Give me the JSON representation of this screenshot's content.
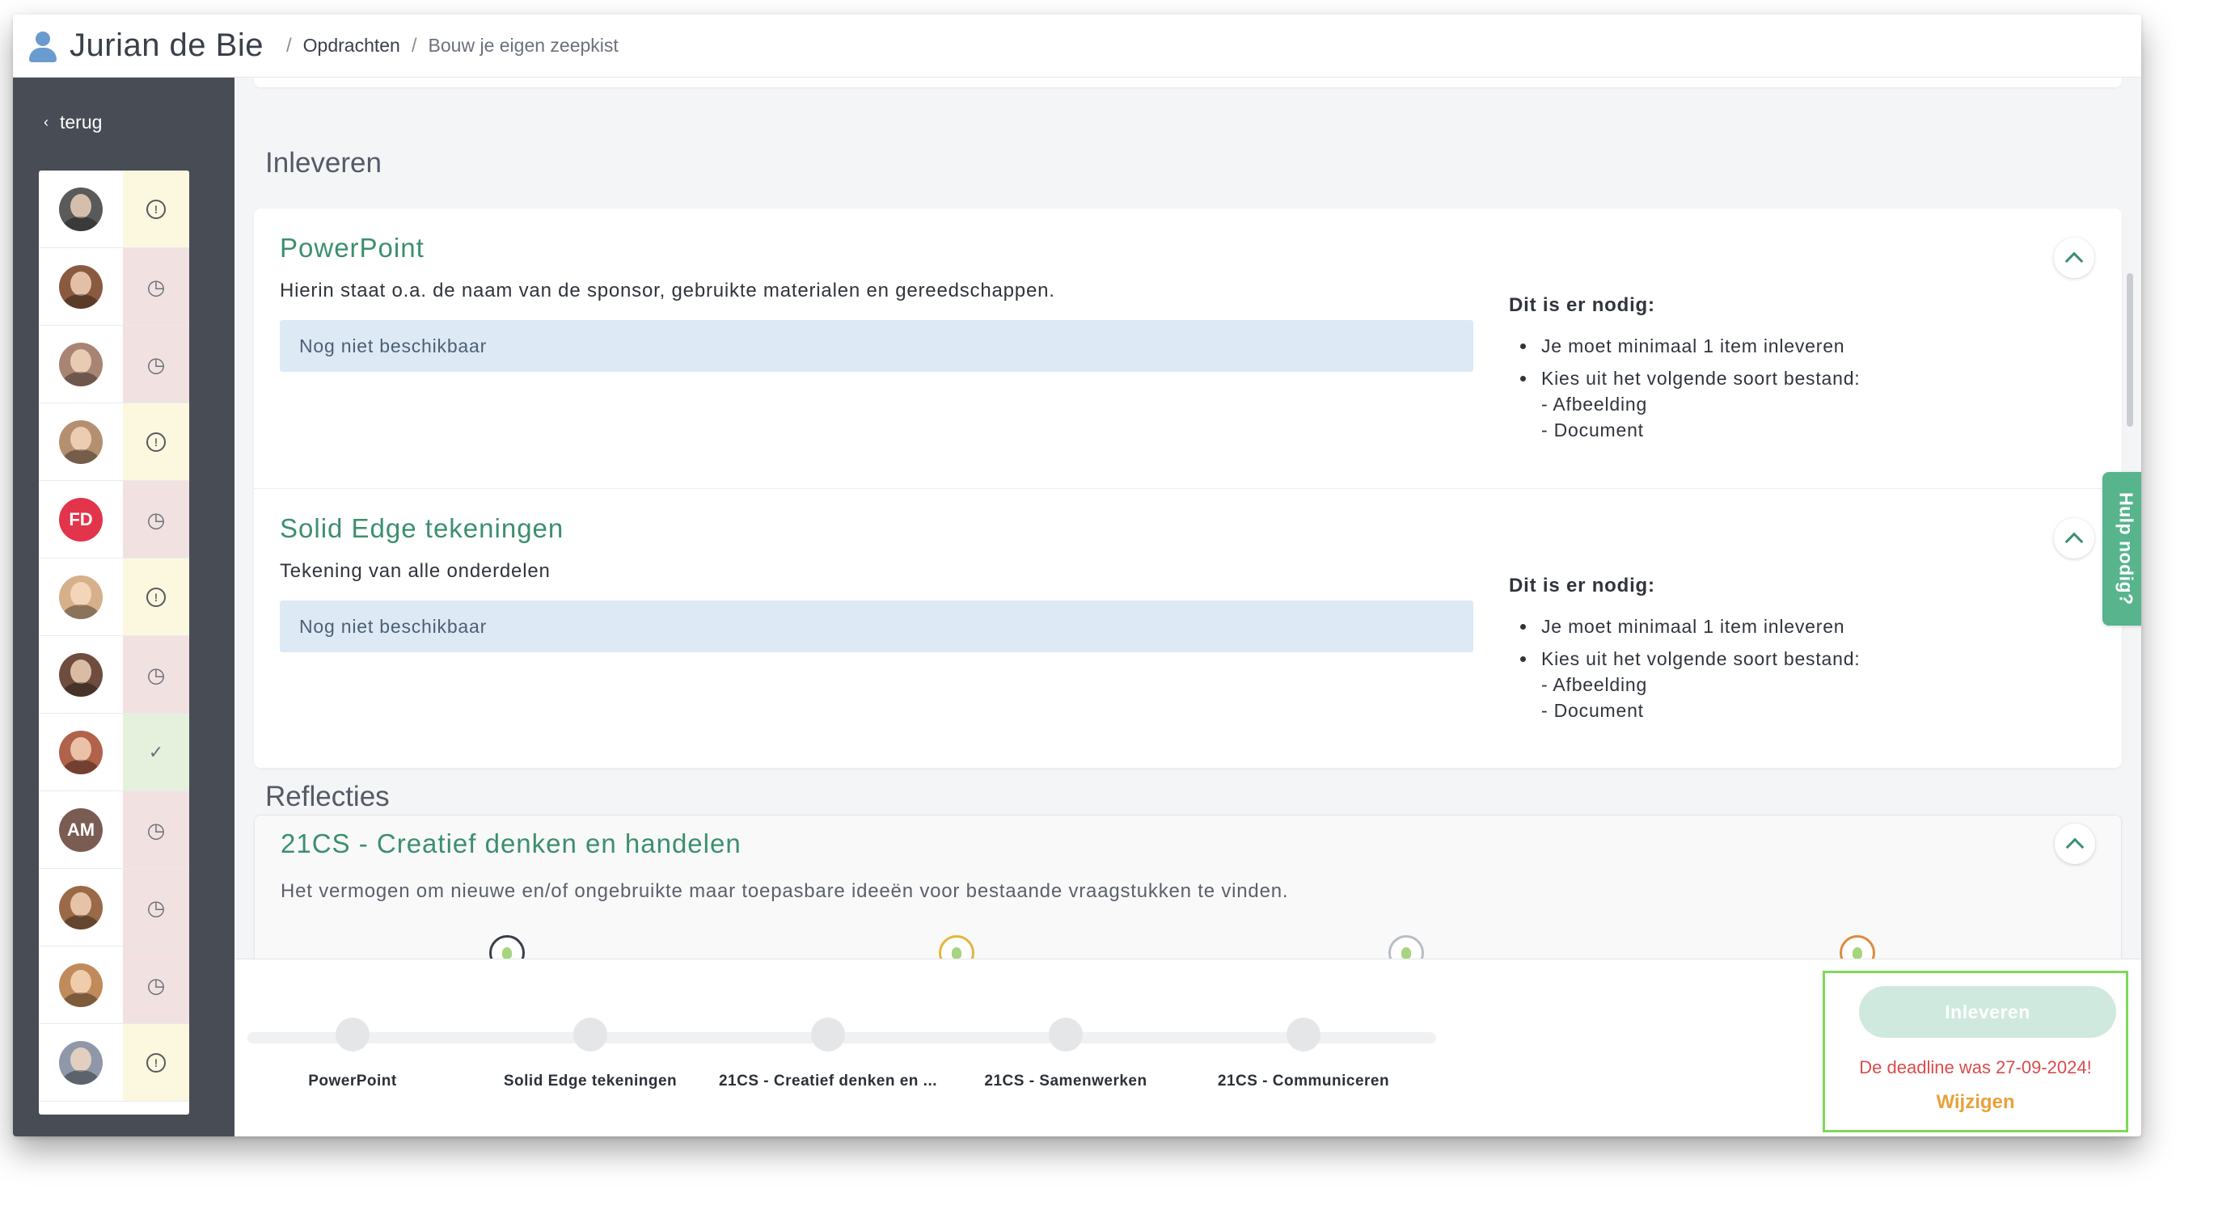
{
  "header": {
    "user_name": "Jurian de Bie",
    "breadcrumb": [
      {
        "label": "Opdrachten",
        "separator": "/"
      },
      {
        "label": "Bouw je eigen zeepkist",
        "separator": "/"
      }
    ]
  },
  "sidebar": {
    "back_label": "terug",
    "students": [
      {
        "avatar": "photo",
        "color": "#5a5a5a",
        "initials": "",
        "status": "warning",
        "status_icon": "!"
      },
      {
        "avatar": "photo",
        "color": "#8a5a40",
        "initials": "",
        "status": "late",
        "status_icon": "clock"
      },
      {
        "avatar": "photo",
        "color": "#a88474",
        "initials": "",
        "status": "late",
        "status_icon": "clock"
      },
      {
        "avatar": "photo",
        "color": "#b49070",
        "initials": "",
        "status": "warning",
        "status_icon": "!"
      },
      {
        "avatar": "initials",
        "color": "#e2344a",
        "initials": "FD",
        "status": "late",
        "status_icon": "clock"
      },
      {
        "avatar": "photo",
        "color": "#d6b08a",
        "initials": "",
        "status": "warning",
        "status_icon": "!"
      },
      {
        "avatar": "photo",
        "color": "#6e4d3f",
        "initials": "",
        "status": "late",
        "status_icon": "clock"
      },
      {
        "avatar": "photo",
        "color": "#b0624a",
        "initials": "",
        "status": "done",
        "status_icon": "check"
      },
      {
        "avatar": "initials",
        "color": "#7a5c52",
        "initials": "AM",
        "status": "late",
        "status_icon": "clock"
      },
      {
        "avatar": "photo",
        "color": "#9a6a48",
        "initials": "",
        "status": "late",
        "status_icon": "clock"
      },
      {
        "avatar": "photo",
        "color": "#c08a5a",
        "initials": "",
        "status": "late",
        "status_icon": "clock"
      },
      {
        "avatar": "photo",
        "color": "#8f98a8",
        "initials": "",
        "status": "warning",
        "status_icon": "!"
      }
    ]
  },
  "main": {
    "inleveren_title": "Inleveren",
    "assignments": [
      {
        "title": "PowerPoint",
        "description": "Hierin staat o.a. de naam van de sponsor, gebruikte materialen en gereedschappen.",
        "box_text": "Nog niet beschikbaar",
        "req_title": "Dit is er nodig:",
        "req_min": "Je moet minimaal 1 item inleveren",
        "req_types": "Kies uit het volgende soort bestand:",
        "req_type_1": "- Afbeelding",
        "req_type_2": "- Document"
      },
      {
        "title": "Solid Edge tekeningen",
        "description": "Tekening van alle onderdelen",
        "box_text": "Nog niet beschikbaar",
        "req_title": "Dit is er nodig:",
        "req_min": "Je moet minimaal 1 item inleveren",
        "req_types": "Kies uit het volgende soort bestand:",
        "req_type_1": "- Afbeelding",
        "req_type_2": "- Document"
      }
    ],
    "reflecties_title": "Reflecties",
    "reflection": {
      "title": "21CS - Creatief denken en handelen",
      "description": "Het vermogen om nieuwe en/of ongebruikte maar toepasbare ideeën voor bestaande vraagstukken te vinden.",
      "dot_colors": [
        "#3a3f4a",
        "#e2b53c",
        "#b8bdc4",
        "#e08a3c"
      ]
    },
    "help_label": "Hulp nodig?"
  },
  "footer": {
    "steps": [
      {
        "label": "PowerPoint"
      },
      {
        "label": "Solid Edge tekeningen"
      },
      {
        "label": "21CS - Creatief denken en ..."
      },
      {
        "label": "21CS - Samenwerken"
      },
      {
        "label": "21CS - Communiceren"
      }
    ],
    "submit_label": "Inleveren",
    "deadline_text": "De deadline was 27-09-2024!",
    "change_label": "Wijzigen"
  },
  "colors": {
    "accent": "#3c8f6e",
    "help_tab": "#57b48d",
    "deadline": "#d94b4b",
    "change_link": "#e8a13a",
    "highlight_border": "#7ed957"
  }
}
